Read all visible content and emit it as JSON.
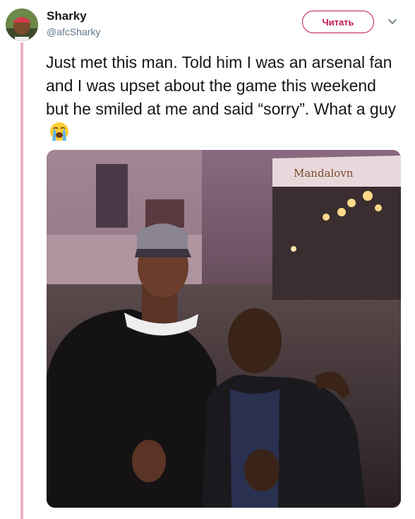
{
  "author": {
    "name": "Sharky",
    "handle": "@afcSharky"
  },
  "header": {
    "follow_label": "Читать"
  },
  "tweet": {
    "text": "Just met this man. Told him I was an arsenal fan and I was upset about the game this weekend but he smiled at me and said “sorry”. What a guy",
    "emoji": "loudly-crying-face"
  },
  "photo": {
    "sign_text": "Mandalovn"
  },
  "colors": {
    "accent": "#c2185b",
    "thread_line": "#e9b3c6",
    "text": "#14171a",
    "muted": "#657786"
  }
}
